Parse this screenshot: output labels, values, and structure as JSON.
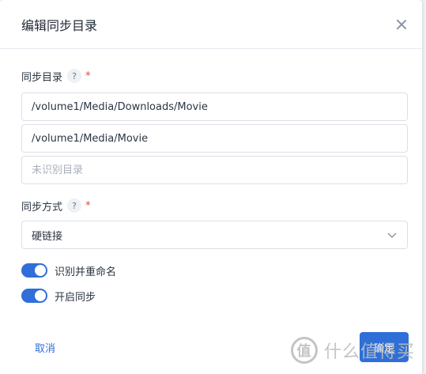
{
  "dialog": {
    "title": "编辑同步目录",
    "close_icon": "close-icon"
  },
  "sync_dirs": {
    "label": "同步目录",
    "help": "?",
    "required_mark": "*",
    "fields": [
      {
        "value": "/volume1/Media/Downloads/Movie",
        "placeholder": ""
      },
      {
        "value": "/volume1/Media/Movie",
        "placeholder": ""
      },
      {
        "value": "",
        "placeholder": "未识别目录"
      }
    ]
  },
  "sync_mode": {
    "label": "同步方式",
    "help": "?",
    "required_mark": "*",
    "selected": "硬链接",
    "dropdown_icon": "chevron-down-icon"
  },
  "toggles": [
    {
      "label": "识别并重命名",
      "on": true
    },
    {
      "label": "开启同步",
      "on": true
    }
  ],
  "footer": {
    "cancel_label": "取消",
    "confirm_label": "确定"
  },
  "watermark": {
    "logo": "值",
    "text": "什么值得买"
  },
  "colors": {
    "accent": "#2f6fd7",
    "required": "#e5483c"
  }
}
